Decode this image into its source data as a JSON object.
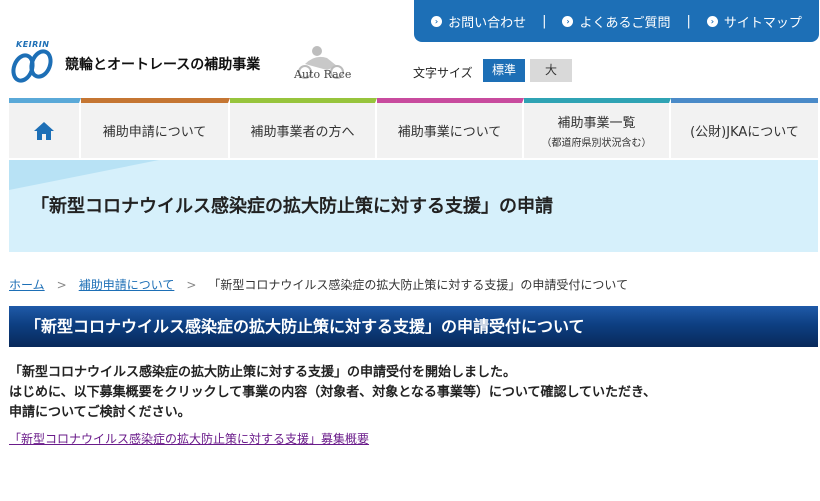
{
  "utility": {
    "items": [
      {
        "label": "お問い合わせ",
        "icon": "chevron-right-icon"
      },
      {
        "label": "よくあるご質問",
        "icon": "chevron-right-icon"
      },
      {
        "label": "サイトマップ",
        "icon": "chevron-right-icon"
      }
    ],
    "separator": "|"
  },
  "header": {
    "logo_text": "KEIRIN",
    "site_title": "競輪とオートレースの補助事業",
    "autorace_text": "Auto Race",
    "fontsize_label": "文字サイズ",
    "fontsize_standard": "標準",
    "fontsize_large": "大"
  },
  "nav": {
    "home_icon": "home-icon",
    "items": [
      {
        "label": "補助申請について",
        "sub": ""
      },
      {
        "label": "補助事業者の方へ",
        "sub": ""
      },
      {
        "label": "補助事業について",
        "sub": ""
      },
      {
        "label": "補助事業一覧",
        "sub": "（都道府県別状況含む）"
      },
      {
        "label": "(公財)JKAについて",
        "sub": ""
      }
    ]
  },
  "banner": {
    "title": "「新型コロナウイルス感染症の拡大防止策に対する支援」の申請"
  },
  "breadcrumb": {
    "home": "ホーム",
    "parent": "補助申請について",
    "current": "「新型コロナウイルス感染症の拡大防止策に対する支援」の申請受付について",
    "separator": ">"
  },
  "section": {
    "title": "「新型コロナウイルス感染症の拡大防止策に対する支援」の申請受付について"
  },
  "content": {
    "line1": "「新型コロナウイルス感染症の拡大防止策に対する支援」の申請受付を開始しました。",
    "line2": "はじめに、以下募集概要をクリックして事業の内容（対象者、対象となる事業等）について確認していただき、",
    "line3": "申請についてご検討ください。",
    "link": "「新型コロナウイルス感染症の拡大防止策に対する支援」募集概要"
  },
  "colors": {
    "brand_blue": "#1d6fb6",
    "banner_bg": "#d6f0fb",
    "section_dark": "#0d3f82",
    "visited_link": "#6a1b8a"
  }
}
